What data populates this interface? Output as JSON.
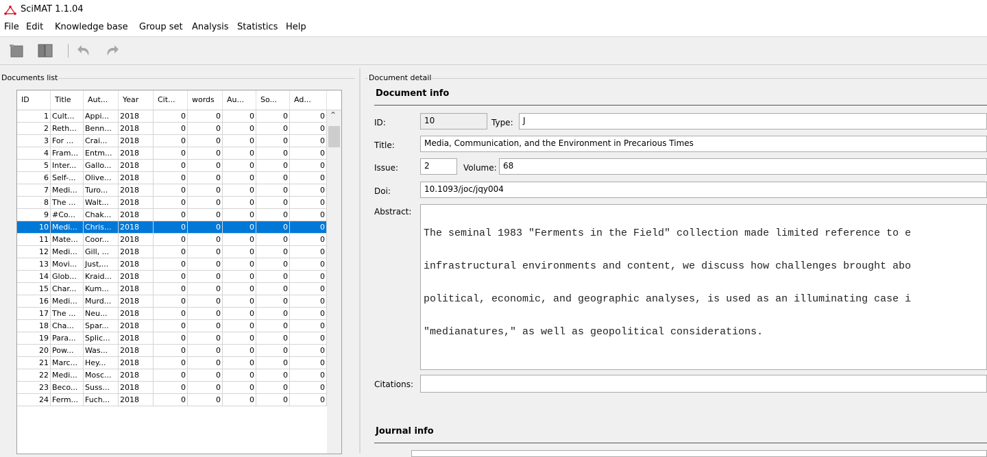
{
  "app": {
    "title": "SciMAT 1.1.04",
    "logo_icon": "scimat-logo-icon"
  },
  "menu": [
    "File",
    "Edit",
    "Knowledge base",
    "Group set",
    "Analysis",
    "Statistics",
    "Help"
  ],
  "toolbar": {
    "icons": [
      "new-icon",
      "open-icon",
      "undo-icon",
      "redo-icon"
    ]
  },
  "documents_list": {
    "label": "Documents list",
    "columns": [
      "ID",
      "Title",
      "Aut...",
      "Year",
      "Cit...",
      "words",
      "Au...",
      "So...",
      "Ad..."
    ],
    "rows": [
      [
        "1",
        "Cult...",
        "Appi...",
        "2018",
        "0",
        "0",
        "0",
        "0",
        "0"
      ],
      [
        "2",
        "Reth...",
        "Benn...",
        "2018",
        "0",
        "0",
        "0",
        "0",
        "0"
      ],
      [
        "3",
        "For ...",
        "Crai...",
        "2018",
        "0",
        "0",
        "0",
        "0",
        "0"
      ],
      [
        "4",
        "Fram...",
        "Entm...",
        "2018",
        "0",
        "0",
        "0",
        "0",
        "0"
      ],
      [
        "5",
        "Inter...",
        "Gallo...",
        "2018",
        "0",
        "0",
        "0",
        "0",
        "0"
      ],
      [
        "6",
        "Self-...",
        "Olive...",
        "2018",
        "0",
        "0",
        "0",
        "0",
        "0"
      ],
      [
        "7",
        "Medi...",
        "Turo...",
        "2018",
        "0",
        "0",
        "0",
        "0",
        "0"
      ],
      [
        "8",
        "The ...",
        "Walt...",
        "2018",
        "0",
        "0",
        "0",
        "0",
        "0"
      ],
      [
        "9",
        "#Co...",
        "Chak...",
        "2018",
        "0",
        "0",
        "0",
        "0",
        "0"
      ],
      [
        "10",
        "Medi...",
        "Chris...",
        "2018",
        "0",
        "0",
        "0",
        "0",
        "0"
      ],
      [
        "11",
        "Mate...",
        "Coor...",
        "2018",
        "0",
        "0",
        "0",
        "0",
        "0"
      ],
      [
        "12",
        "Medi...",
        "Gill, ...",
        "2018",
        "0",
        "0",
        "0",
        "0",
        "0"
      ],
      [
        "13",
        "Movi...",
        "Just,...",
        "2018",
        "0",
        "0",
        "0",
        "0",
        "0"
      ],
      [
        "14",
        "Glob...",
        "Kraid...",
        "2018",
        "0",
        "0",
        "0",
        "0",
        "0"
      ],
      [
        "15",
        "Char...",
        "Kum...",
        "2018",
        "0",
        "0",
        "0",
        "0",
        "0"
      ],
      [
        "16",
        "Medi...",
        "Murd...",
        "2018",
        "0",
        "0",
        "0",
        "0",
        "0"
      ],
      [
        "17",
        "The ...",
        "Neu...",
        "2018",
        "0",
        "0",
        "0",
        "0",
        "0"
      ],
      [
        "18",
        "Cha...",
        "Spar...",
        "2018",
        "0",
        "0",
        "0",
        "0",
        "0"
      ],
      [
        "19",
        "Para...",
        "Splic...",
        "2018",
        "0",
        "0",
        "0",
        "0",
        "0"
      ],
      [
        "20",
        "Pow...",
        "Was...",
        "2018",
        "0",
        "0",
        "0",
        "0",
        "0"
      ],
      [
        "21",
        "Marc...",
        "Hey...",
        "2018",
        "0",
        "0",
        "0",
        "0",
        "0"
      ],
      [
        "22",
        "Medi...",
        "Mosc...",
        "2018",
        "0",
        "0",
        "0",
        "0",
        "0"
      ],
      [
        "23",
        "Beco...",
        "Suss...",
        "2018",
        "0",
        "0",
        "0",
        "0",
        "0"
      ],
      [
        "24",
        "Ferm...",
        "Fuch...",
        "2018",
        "0",
        "0",
        "0",
        "0",
        "0"
      ]
    ],
    "selected_id": "10"
  },
  "document_detail": {
    "label": "Document detail",
    "document_info_title": "Document info",
    "id_label": "ID:",
    "id_value": "10",
    "type_label": "Type:",
    "type_value": "J",
    "title_label": "Title:",
    "title_value": "Media, Communication, and the Environment in Precarious Times",
    "issue_label": "Issue:",
    "issue_value": "2",
    "volume_label": "Volume:",
    "volume_value": "68",
    "doi_label": "Doi:",
    "doi_value": "10.1093/joc/jqy004",
    "abstract_label": "Abstract:",
    "abstract_lines": [
      "The seminal 1983 \"Ferments in the Field\" collection made limited reference to e",
      "infrastructural environments and content, we discuss how challenges brought abo",
      "political, economic, and geographic analyses, is used as an illuminating case i",
      "\"medianatures,\" as well as geopolitical considerations."
    ],
    "citations_label": "Citations:",
    "citations_value": "",
    "journal_info_title": "Journal info"
  },
  "colors": {
    "selection": "#0078d7",
    "window_bg": "#f0f0f0"
  }
}
